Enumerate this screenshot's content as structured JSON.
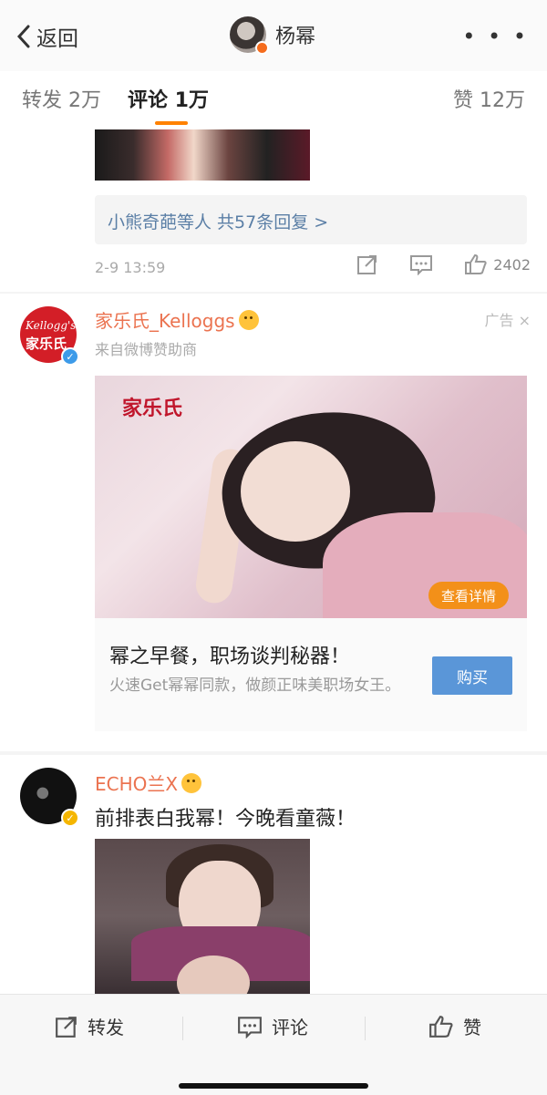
{
  "nav": {
    "back_label": "返回",
    "title": "杨幂",
    "more_label": "• • •"
  },
  "tabs": [
    {
      "label": "转发 2万"
    },
    {
      "label": "评论 1万"
    },
    {
      "label": "赞 12万"
    }
  ],
  "comment1": {
    "reply_text": "小熊奇葩等人  共57条回复 >",
    "time": "2-9 13:59",
    "like_count": "2402"
  },
  "ad": {
    "name": "家乐氏_Kelloggs",
    "source": "来自微博赞助商",
    "tag": "广告 ×",
    "avatar_line1": "Kellogg's",
    "avatar_line2": "家乐氏",
    "image_logo": "家乐氏",
    "view_button": "查看详情",
    "headline": "幂之早餐，职场谈判秘器！",
    "description": "火速Get幂幂同款，做颜正味美职场女王。",
    "buy_button": "购买"
  },
  "comment2": {
    "name": "ECHO兰X",
    "text": "前排表白我幂！今晚看童薇！"
  },
  "bottom_bar": {
    "repost": "转发",
    "comment": "评论",
    "like": "赞"
  }
}
